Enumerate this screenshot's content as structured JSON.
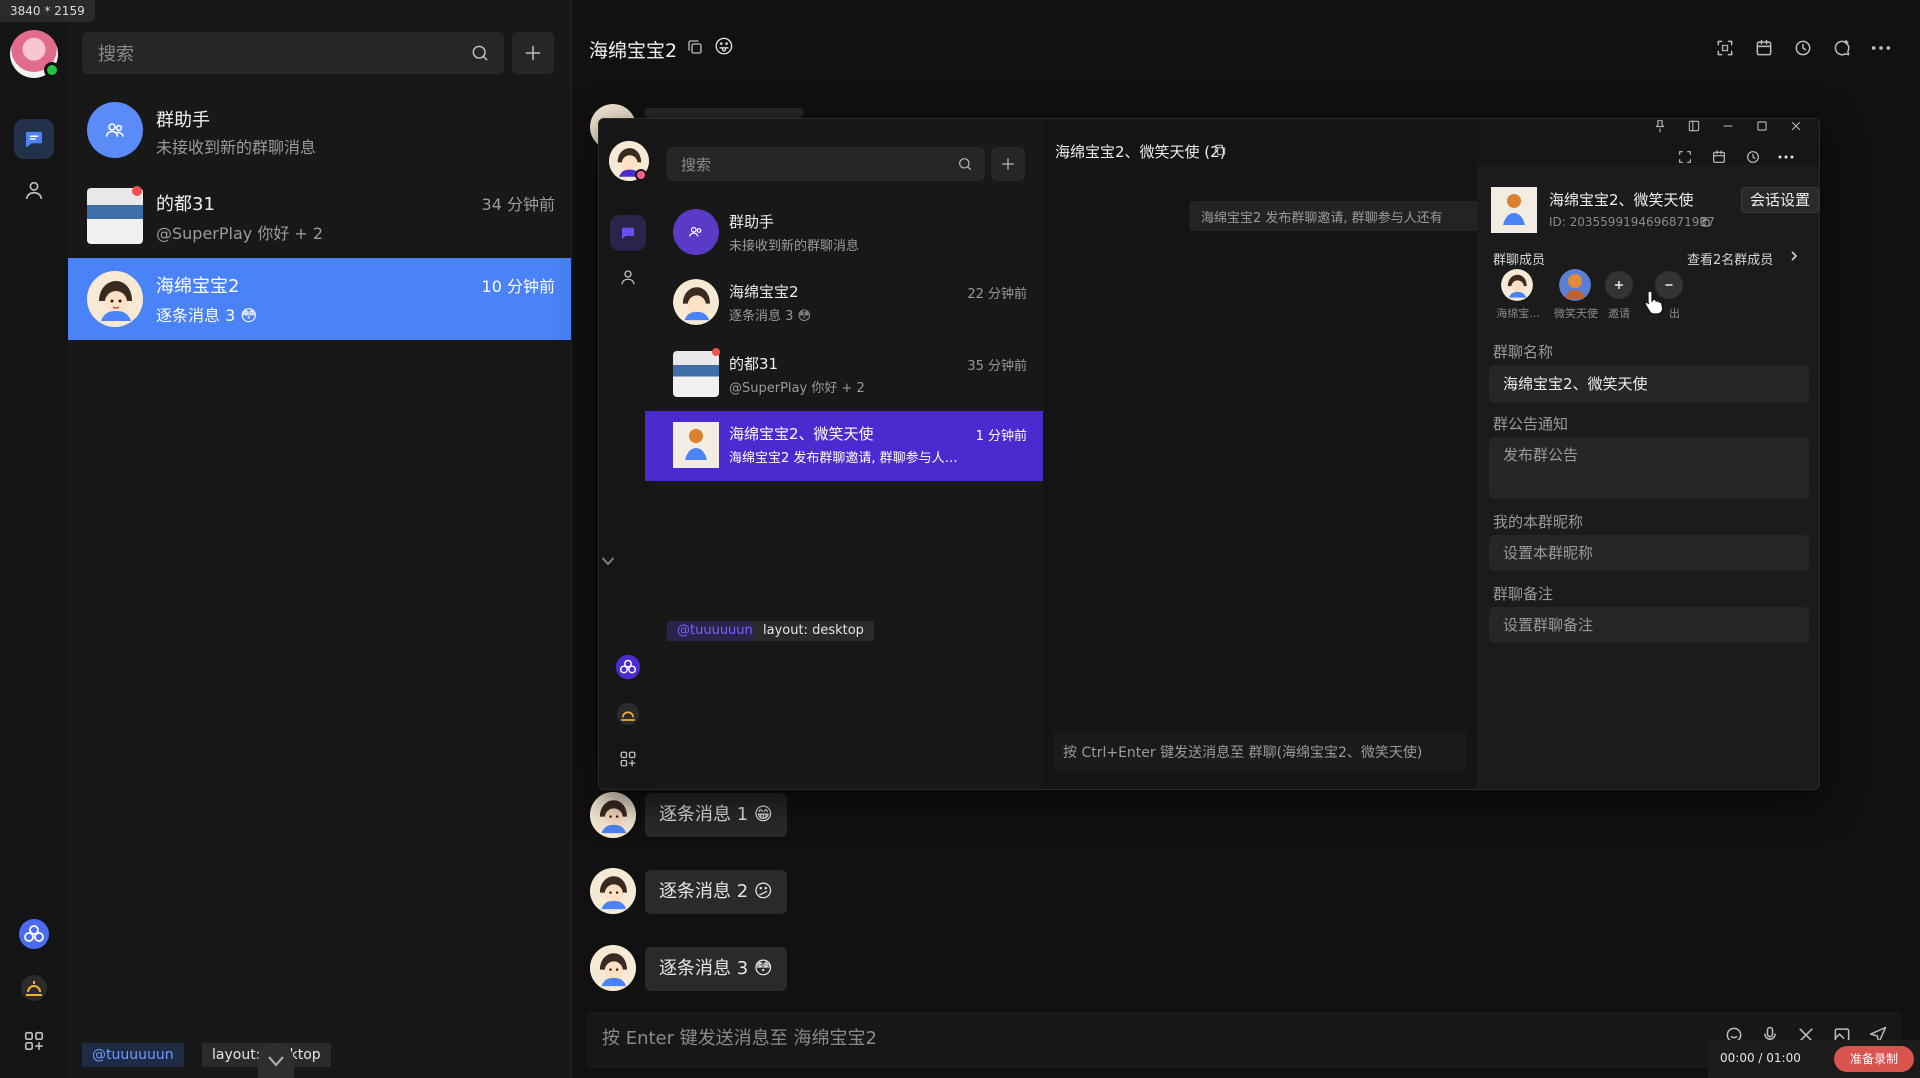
{
  "size_badge": "3840 * 2159",
  "colors": {
    "accent_blue": "#4a83f7",
    "accent_purple": "#4b2bd0",
    "online_green": "#23c343",
    "record_red": "#d9534f"
  },
  "outer": {
    "search": {
      "placeholder": "搜索"
    },
    "conversations": [
      {
        "name": "群助手",
        "message": "未接收到新的群聊消息",
        "time": "",
        "icon": "group-assistant-icon"
      },
      {
        "name": "的都31",
        "message": "@SuperPlay 你好 + 2",
        "time": "34 分钟前"
      },
      {
        "name": "海绵宝宝2",
        "message": "逐条消息 3 😳",
        "time": "10 分钟前",
        "active": true
      }
    ],
    "chat": {
      "title": "海绵宝宝2",
      "title_emoji": "😛",
      "messages": [
        {
          "text": "逐条消息 1 😁"
        },
        {
          "text": "逐条消息 2 😕"
        },
        {
          "text": "逐条消息 3 😳"
        }
      ],
      "input_placeholder": "按 Enter 键发送消息至 海绵宝宝2"
    },
    "tags": {
      "user": "@tuuuuuun",
      "layout": "layout: desktop"
    },
    "recorder": {
      "time": "00:00 / 01:00",
      "record_label": "准备录制"
    }
  },
  "inner": {
    "search": {
      "placeholder": "搜索"
    },
    "conversations": [
      {
        "name": "群助手",
        "message": "未接收到新的群聊消息",
        "time": ""
      },
      {
        "name": "海绵宝宝2",
        "message": "逐条消息 3 😳",
        "time": "22 分钟前"
      },
      {
        "name": "的都31",
        "message": "@SuperPlay 你好 + 2",
        "time": "35 分钟前"
      },
      {
        "name": "海绵宝宝2、微笑天使",
        "message": "海绵宝宝2 发布群聊邀请, 群聊参与人还有: ...",
        "time": "1 分钟前",
        "active": true
      }
    ],
    "chat": {
      "title": "海绵宝宝2、微笑天使 (2)",
      "system_notice": "海绵宝宝2 发布群聊邀请, 群聊参与人还有",
      "input_placeholder": "按 Ctrl+Enter 键发送消息至 群聊(海绵宝宝2、微笑天使)"
    },
    "tags": {
      "user": "@tuuuuuun",
      "layout": "layout: desktop"
    },
    "panel": {
      "group_name": "海绵宝宝2、微笑天使",
      "group_id": "ID: 2035599194696871937",
      "share_label": "分享",
      "members_title": "群聊成员",
      "view_members": "查看2名群成员",
      "members": [
        {
          "name": "海绵宝..."
        },
        {
          "name": "微笑天使"
        }
      ],
      "invite_label": "邀请",
      "remove_label": "出",
      "name_label": "群聊名称",
      "name_value": "海绵宝宝2、微笑天使",
      "notice_label": "群公告通知",
      "notice_placeholder": "发布群公告",
      "nickname_label": "我的本群昵称",
      "nickname_placeholder": "设置本群昵称",
      "remark_label": "群聊备注",
      "remark_placeholder": "设置群聊备注"
    },
    "tooltip": "会话设置"
  }
}
